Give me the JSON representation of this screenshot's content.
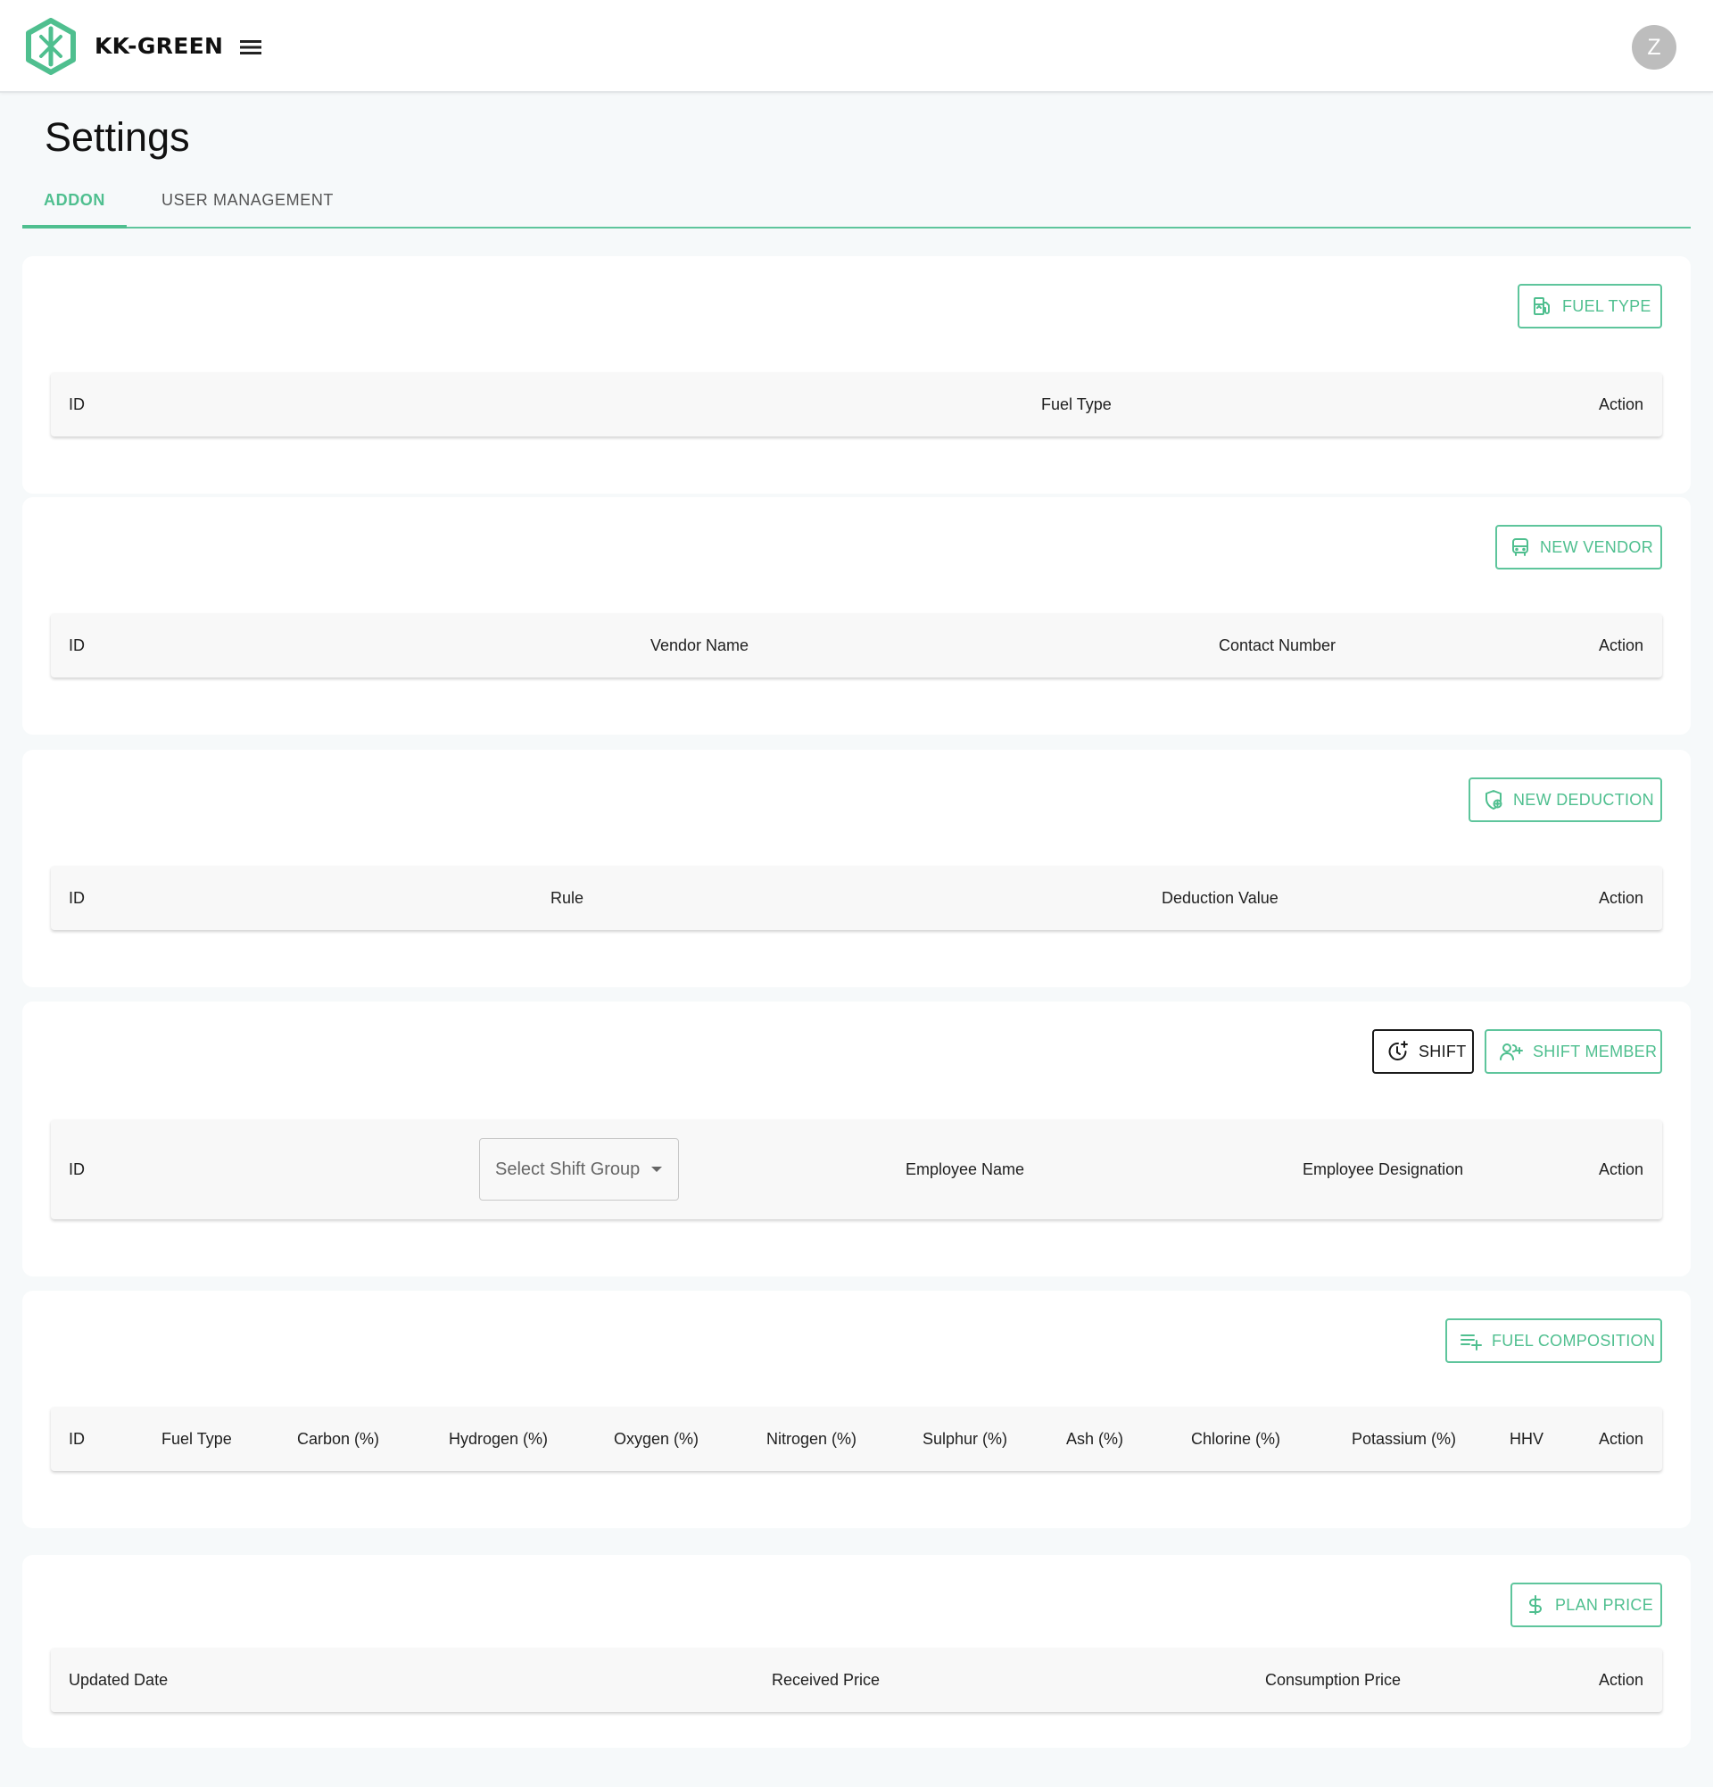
{
  "app": {
    "brand": "KK-GREEN",
    "avatar_initial": "Z"
  },
  "colors": {
    "accent": "#4fbf8f",
    "page_bg": "#f6f9fa",
    "card_bg": "#ffffff",
    "header_bg": "#f8f8f8"
  },
  "page": {
    "title": "Settings"
  },
  "tabs": [
    {
      "label": "ADDON",
      "active": true
    },
    {
      "label": "USER MANAGEMENT",
      "active": false
    }
  ],
  "fuel_type_section": {
    "button": {
      "label": "FUEL TYPE",
      "icon": "fuel-pump-icon"
    },
    "columns": [
      "ID",
      "Fuel Type",
      "Action"
    ]
  },
  "vendor_section": {
    "button": {
      "label": "NEW VENDOR",
      "icon": "bus-icon"
    },
    "columns": [
      "ID",
      "Vendor Name",
      "Contact Number",
      "Action"
    ]
  },
  "deduction_section": {
    "button": {
      "label": "NEW DEDUCTION",
      "icon": "shield-plus-icon"
    },
    "columns": [
      "ID",
      "Rule",
      "Deduction Value",
      "Action"
    ]
  },
  "shift_section": {
    "shift_button": {
      "label": "SHIFT",
      "icon": "clock-plus-icon"
    },
    "member_button": {
      "label": "SHIFT MEMBER",
      "icon": "user-add-icon"
    },
    "select_placeholder": "Select Shift Group",
    "columns": [
      "ID",
      "Employee Name",
      "Employee Designation",
      "Action"
    ]
  },
  "composition_section": {
    "button": {
      "label": "FUEL COMPOSITION",
      "icon": "playlist-add-icon"
    },
    "columns": [
      "ID",
      "Fuel Type",
      "Carbon (%)",
      "Hydrogen (%)",
      "Oxygen (%)",
      "Nitrogen (%)",
      "Sulphur (%)",
      "Ash (%)",
      "Chlorine (%)",
      "Potassium (%)",
      "HHV",
      "Action"
    ]
  },
  "plan_price_section": {
    "button": {
      "label": "PLAN PRICE",
      "icon": "dollar-icon"
    },
    "columns": [
      "Updated Date",
      "Received Price",
      "Consumption Price",
      "Action"
    ]
  }
}
